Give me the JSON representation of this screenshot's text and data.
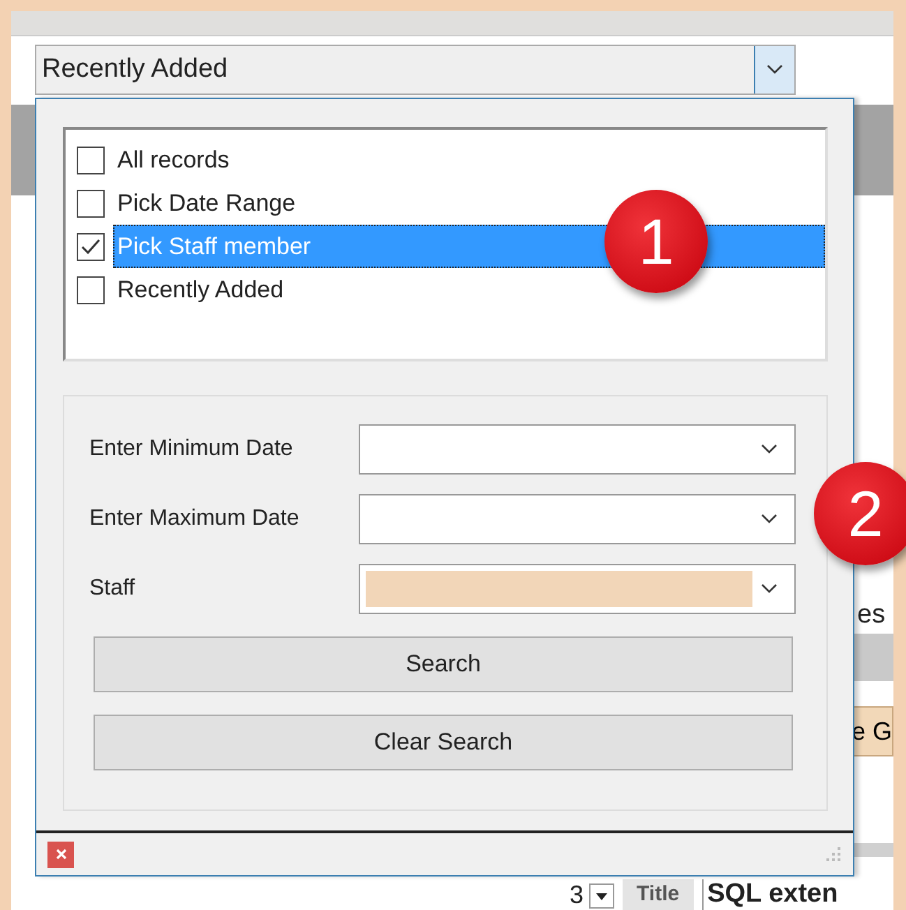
{
  "combo": {
    "value": "Recently Added"
  },
  "options": [
    {
      "label": "All records",
      "checked": false,
      "selected": false
    },
    {
      "label": "Pick Date Range",
      "checked": false,
      "selected": false
    },
    {
      "label": "Pick Staff member",
      "checked": true,
      "selected": true
    },
    {
      "label": "Recently Added",
      "checked": false,
      "selected": false
    }
  ],
  "fields": [
    {
      "label": "Enter Minimum Date",
      "highlighted": false
    },
    {
      "label": "Enter Maximum Date",
      "highlighted": false
    },
    {
      "label": "Staff",
      "highlighted": true
    }
  ],
  "buttons": [
    "Search",
    "Clear Search"
  ],
  "badges": [
    "1",
    "2"
  ],
  "background": {
    "fragments": [
      "es",
      "e G"
    ],
    "spinner_value": "3",
    "field_label": "Title",
    "field_value": "SQL exten"
  }
}
